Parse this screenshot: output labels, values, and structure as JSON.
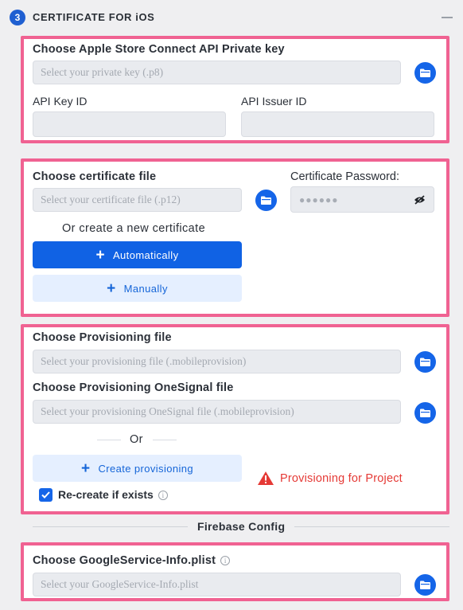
{
  "header": {
    "step_number": "3",
    "title": "CERTIFICATE FOR iOS"
  },
  "api_key_card": {
    "private_key_label": "Choose Apple Store Connect API Private key",
    "private_key_placeholder": "Select your private key (.p8)",
    "api_key_id_label": "API Key ID",
    "api_key_id_value": "",
    "api_issuer_id_label": "API Issuer ID",
    "api_issuer_id_value": ""
  },
  "certificate_card": {
    "cert_file_label": "Choose certificate file",
    "cert_file_placeholder": "Select your certificate file (.p12)",
    "password_label": "Certificate Password:",
    "password_masked": "●●●●●●",
    "or_create_label": "Or create a new certificate",
    "automatically_label": "Automatically",
    "manually_label": "Manually"
  },
  "provisioning_card": {
    "provisioning_label": "Choose Provisioning file",
    "provisioning_placeholder": "Select your provisioning file (.mobileprovision)",
    "onesignal_label": "Choose Provisioning OneSignal file",
    "onesignal_placeholder": "Select your provisioning OneSignal file (.mobileprovision)",
    "or_label": "Or",
    "create_provisioning_label": "Create provisioning",
    "recreate_label": "Re-create if exists",
    "recreate_checked": true,
    "warning_text": "Provisioning for Project"
  },
  "firebase": {
    "section_title": "Firebase Config",
    "plist_label": "Choose GoogleService-Info.plist",
    "plist_placeholder": "Select your GoogleService-Info.plist"
  },
  "colors": {
    "accent": "#1565e8",
    "highlight_border": "#f06292",
    "warning": "#e53935"
  }
}
